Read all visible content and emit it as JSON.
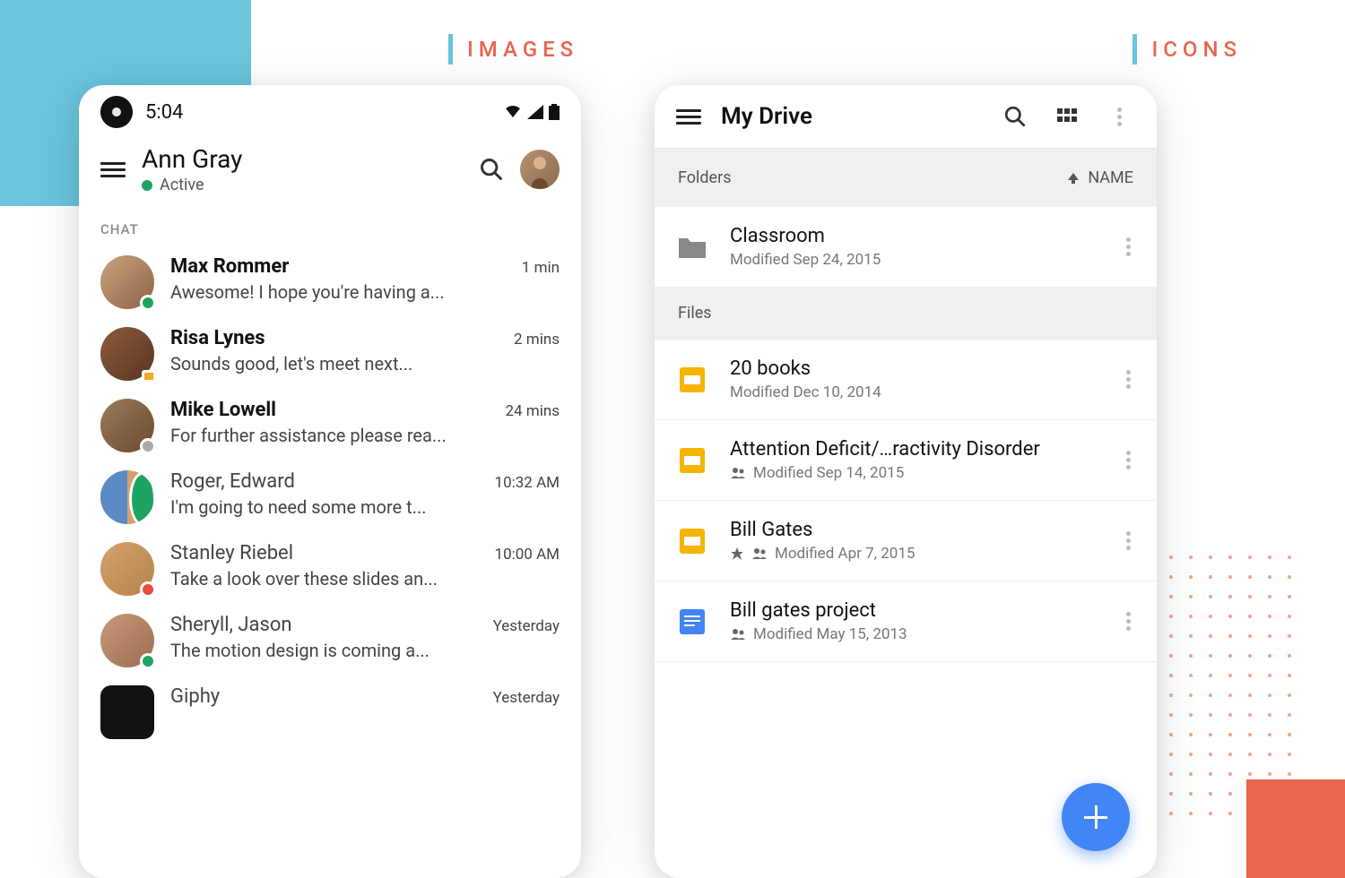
{
  "headings": {
    "images": "IMAGES",
    "icons": "ICONS"
  },
  "chatApp": {
    "statusTime": "5:04",
    "user": {
      "name": "Ann Gray",
      "status": "Active"
    },
    "sectionLabel": "CHAT",
    "conversations": [
      {
        "name": "Max Rommer",
        "preview": "Awesome! I hope you're having a...",
        "time": "1 min",
        "bold": true,
        "badge": "green"
      },
      {
        "name": "Risa Lynes",
        "preview": "Sounds good, let's meet next...",
        "time": "2 mins",
        "bold": true,
        "badge": "video"
      },
      {
        "name": "Mike Lowell",
        "preview": "For further assistance please rea...",
        "time": "24 mins",
        "bold": true,
        "badge": "gray"
      },
      {
        "name": "Roger, Edward",
        "preview": "I'm going to need some more t...",
        "time": "10:32 AM",
        "bold": false,
        "badge": "green"
      },
      {
        "name": "Stanley Riebel",
        "preview": "Take a look over these slides an...",
        "time": "10:00 AM",
        "bold": false,
        "badge": "red"
      },
      {
        "name": "Sheryll, Jason",
        "preview": "The motion design is coming  a...",
        "time": "Yesterday",
        "bold": false,
        "badge": "green"
      },
      {
        "name": "Giphy",
        "preview": "",
        "time": "Yesterday",
        "bold": false,
        "badge": ""
      }
    ]
  },
  "driveApp": {
    "title": "My Drive",
    "foldersLabel": "Folders",
    "filesLabel": "Files",
    "sortLabel": "NAME",
    "folders": [
      {
        "name": "Classroom",
        "meta": "Modified Sep 24, 2015"
      }
    ],
    "files": [
      {
        "name": "20 books",
        "meta": "Modified Dec 10, 2014",
        "type": "slides",
        "shared": false,
        "starred": false
      },
      {
        "name": "Attention Deficit/…ractivity Disorder",
        "meta": "Modified Sep 14, 2015",
        "type": "slides",
        "shared": true,
        "starred": false
      },
      {
        "name": "Bill Gates",
        "meta": "Modified Apr 7, 2015",
        "type": "slides",
        "shared": true,
        "starred": true
      },
      {
        "name": "Bill gates project",
        "meta": "Modified May 15, 2013",
        "type": "docs",
        "shared": true,
        "starred": false
      }
    ]
  }
}
